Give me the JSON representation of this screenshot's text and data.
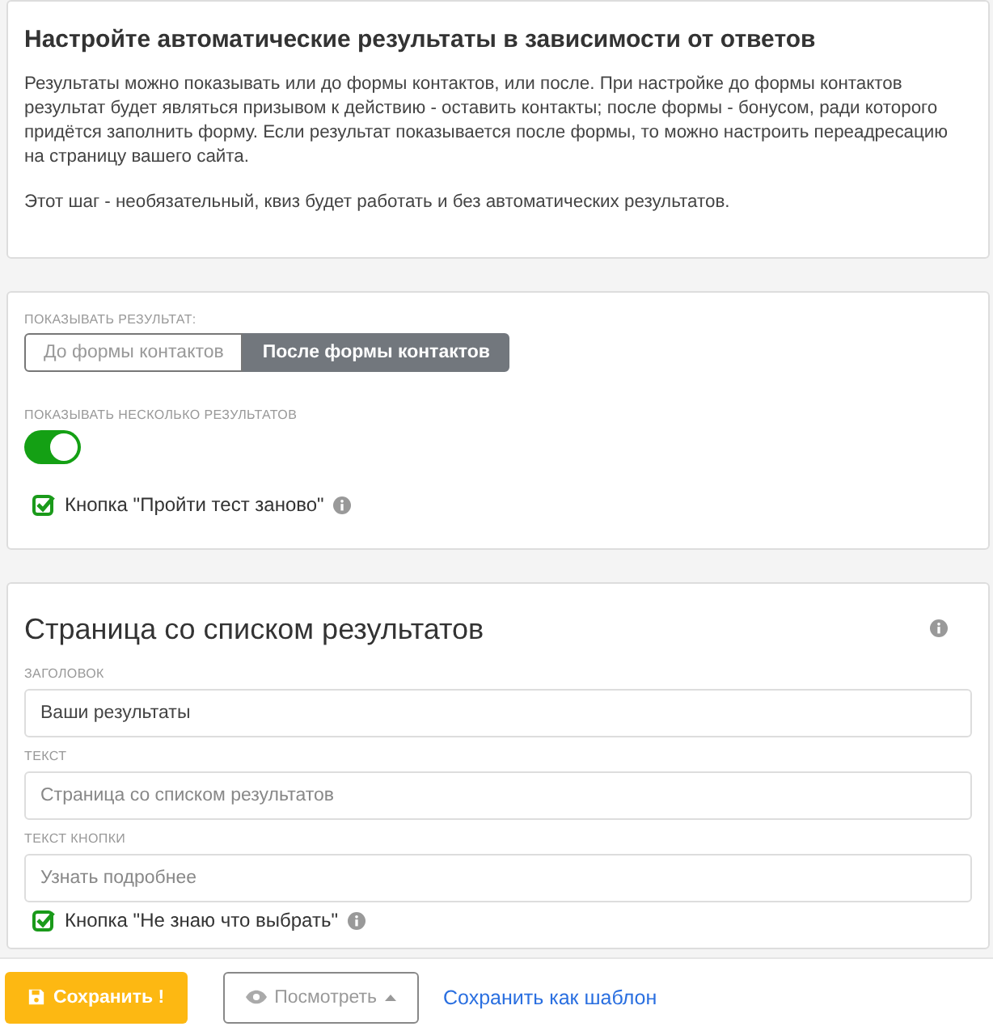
{
  "intro": {
    "title": "Настройте автоматические результаты в зависимости от ответов",
    "paragraphs": [
      "Результаты можно показывать или до формы контактов, или после. При настройке до формы контактов результат будет являться призывом к действию - оставить контакты; после формы - бонусом, ради которого придётся заполнить форму. Если результат показывается после формы, то можно настроить переадресацию на страницу вашего сайта.",
      "Этот шаг - необязательный, квиз будет работать и без автоматических результатов."
    ]
  },
  "display": {
    "label": "ПОКАЗЫВАТЬ РЕЗУЛЬТАТ:",
    "options": [
      {
        "label": "До формы контактов",
        "selected": false
      },
      {
        "label": "После формы контактов",
        "selected": true
      }
    ],
    "multiple_label": "ПОКАЗЫВАТЬ НЕСКОЛЬКО РЕЗУЛЬТАТОВ",
    "multiple_on": true,
    "retry": {
      "label": "Кнопка \"Пройти тест заново\"",
      "checked": true
    }
  },
  "results_page": {
    "title": "Страница со списком результатов",
    "fields": [
      {
        "label": "ЗАГОЛОВОК",
        "value": "Ваши результаты"
      },
      {
        "label": "ТЕКСТ",
        "placeholder": "Страница со списком результатов"
      },
      {
        "label": "ТЕКСТ КНОПКИ",
        "placeholder": "Узнать подробнее"
      }
    ],
    "unsure": {
      "label": "Кнопка \"Не знаю что выбрать\"",
      "checked": true
    }
  },
  "footer": {
    "save": "Сохранить !",
    "preview": "Посмотреть",
    "save_template": "Сохранить как шаблон"
  }
}
